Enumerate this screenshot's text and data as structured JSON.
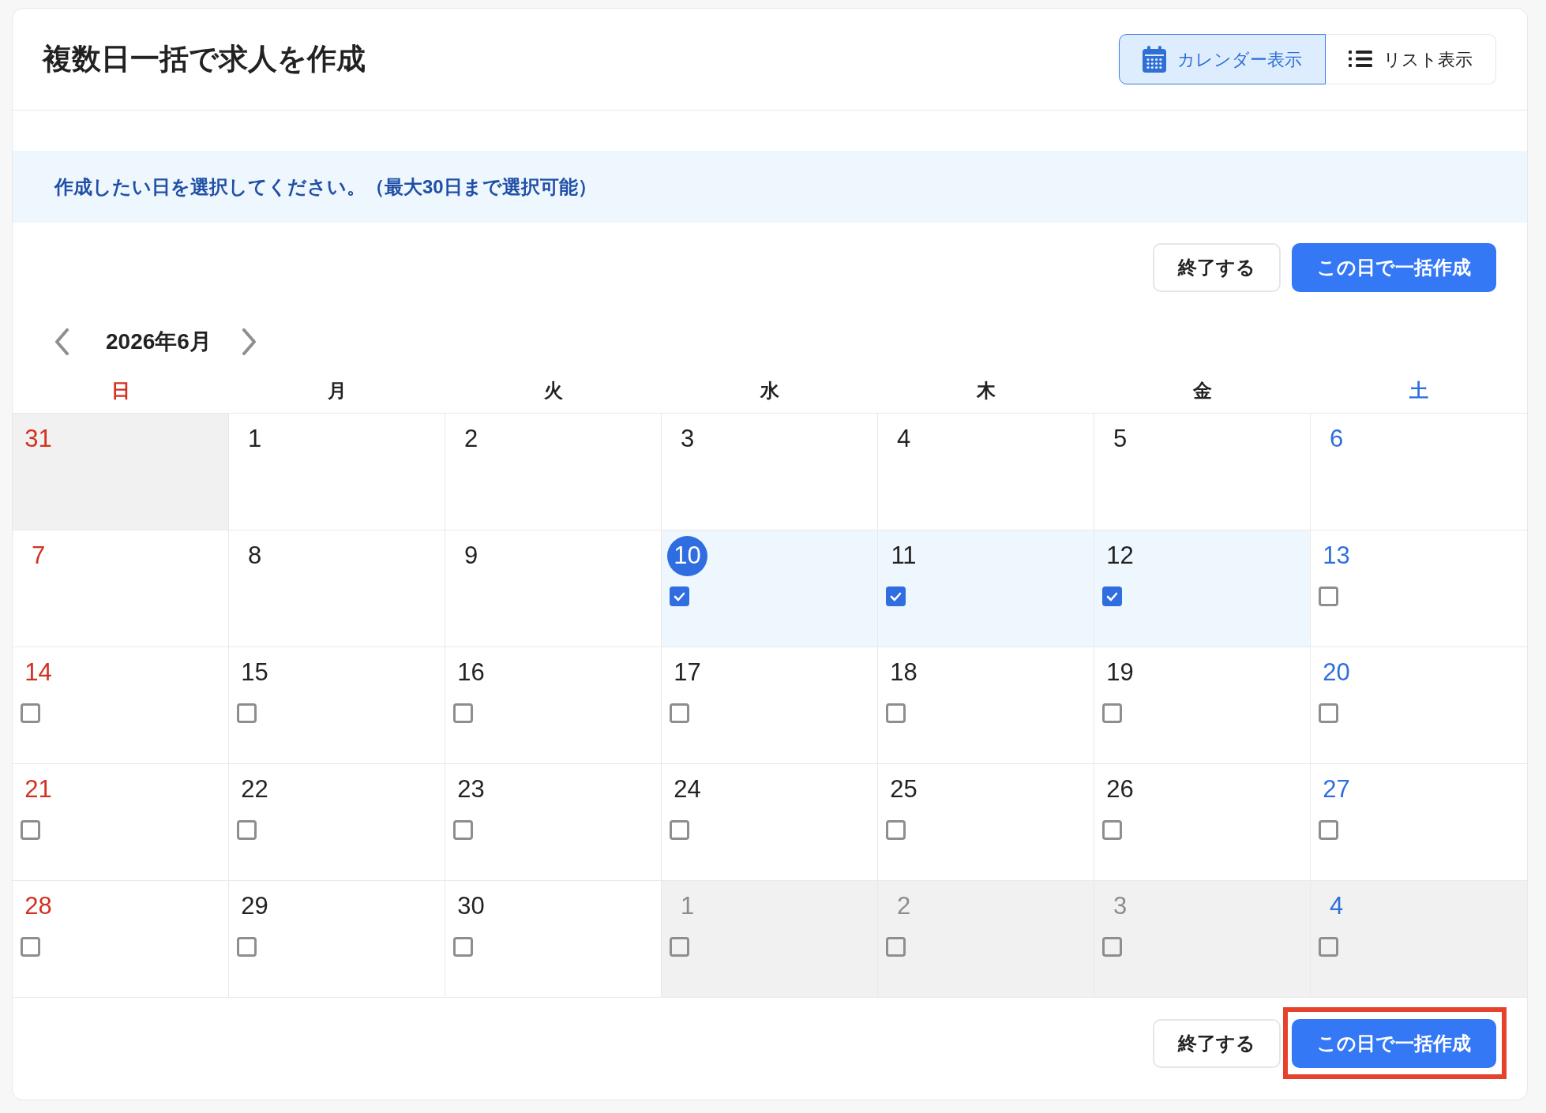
{
  "header": {
    "title": "複数日一括で求人を作成",
    "view_toggle": [
      {
        "label": "カレンダー表示",
        "kind": "calendar",
        "selected": true
      },
      {
        "label": "リスト表示",
        "kind": "list",
        "selected": false
      }
    ]
  },
  "notice": "作成したい日を選択してください。（最大30日まで選択可能）",
  "top_actions": [
    {
      "label": "終了する",
      "kind": "secondary"
    },
    {
      "label": "この日で一括作成",
      "kind": "primary"
    }
  ],
  "calendar": {
    "month": "2026年6月",
    "weekdays": [
      "日",
      "月",
      "火",
      "水",
      "木",
      "金",
      "土"
    ],
    "weeks": [
      [
        {
          "day": "31",
          "kind": "plain",
          "other_month": true,
          "today": false
        },
        {
          "day": "1",
          "kind": "plain",
          "other_month": false,
          "today": false
        },
        {
          "day": "2",
          "kind": "plain",
          "other_month": false,
          "today": false
        },
        {
          "day": "3",
          "kind": "plain",
          "other_month": false,
          "today": false
        },
        {
          "day": "4",
          "kind": "plain",
          "other_month": false,
          "today": false
        },
        {
          "day": "5",
          "kind": "plain",
          "other_month": false,
          "today": false
        },
        {
          "day": "6",
          "kind": "plain",
          "other_month": false,
          "today": false
        }
      ],
      [
        {
          "day": "7",
          "kind": "plain",
          "other_month": false,
          "today": false
        },
        {
          "day": "8",
          "kind": "plain",
          "other_month": false,
          "today": false
        },
        {
          "day": "9",
          "kind": "plain",
          "other_month": false,
          "today": false
        },
        {
          "day": "10",
          "kind": "checkbox",
          "other_month": false,
          "today": true,
          "checked": true
        },
        {
          "day": "11",
          "kind": "checkbox",
          "other_month": false,
          "today": false,
          "checked": true
        },
        {
          "day": "12",
          "kind": "checkbox",
          "other_month": false,
          "today": false,
          "checked": true
        },
        {
          "day": "13",
          "kind": "checkbox",
          "other_month": false,
          "today": false,
          "checked": false
        }
      ],
      [
        {
          "day": "14",
          "kind": "checkbox",
          "other_month": false,
          "today": false,
          "checked": false
        },
        {
          "day": "15",
          "kind": "checkbox",
          "other_month": false,
          "today": false,
          "checked": false
        },
        {
          "day": "16",
          "kind": "checkbox",
          "other_month": false,
          "today": false,
          "checked": false
        },
        {
          "day": "17",
          "kind": "checkbox",
          "other_month": false,
          "today": false,
          "checked": false
        },
        {
          "day": "18",
          "kind": "checkbox",
          "other_month": false,
          "today": false,
          "checked": false
        },
        {
          "day": "19",
          "kind": "checkbox",
          "other_month": false,
          "today": false,
          "checked": false
        },
        {
          "day": "20",
          "kind": "checkbox",
          "other_month": false,
          "today": false,
          "checked": false
        }
      ],
      [
        {
          "day": "21",
          "kind": "checkbox",
          "other_month": false,
          "today": false,
          "checked": false
        },
        {
          "day": "22",
          "kind": "checkbox",
          "other_month": false,
          "today": false,
          "checked": false
        },
        {
          "day": "23",
          "kind": "checkbox",
          "other_month": false,
          "today": false,
          "checked": false
        },
        {
          "day": "24",
          "kind": "checkbox",
          "other_month": false,
          "today": false,
          "checked": false
        },
        {
          "day": "25",
          "kind": "checkbox",
          "other_month": false,
          "today": false,
          "checked": false
        },
        {
          "day": "26",
          "kind": "checkbox",
          "other_month": false,
          "today": false,
          "checked": false
        },
        {
          "day": "27",
          "kind": "checkbox",
          "other_month": false,
          "today": false,
          "checked": false
        }
      ],
      [
        {
          "day": "28",
          "kind": "checkbox",
          "other_month": false,
          "today": false,
          "checked": false
        },
        {
          "day": "29",
          "kind": "checkbox",
          "other_month": false,
          "today": false,
          "checked": false
        },
        {
          "day": "30",
          "kind": "checkbox",
          "other_month": false,
          "today": false,
          "checked": false
        },
        {
          "day": "1",
          "kind": "checkbox",
          "other_month": true,
          "today": false,
          "checked": false
        },
        {
          "day": "2",
          "kind": "checkbox",
          "other_month": true,
          "today": false,
          "checked": false
        },
        {
          "day": "3",
          "kind": "checkbox",
          "other_month": true,
          "today": false,
          "checked": false
        },
        {
          "day": "4",
          "kind": "checkbox",
          "other_month": true,
          "today": false,
          "checked": false
        }
      ]
    ]
  },
  "bottom_actions": [
    {
      "label": "終了する",
      "kind": "secondary",
      "highlighted": false
    },
    {
      "label": "この日で一括作成",
      "kind": "primary",
      "highlighted": true
    }
  ]
}
